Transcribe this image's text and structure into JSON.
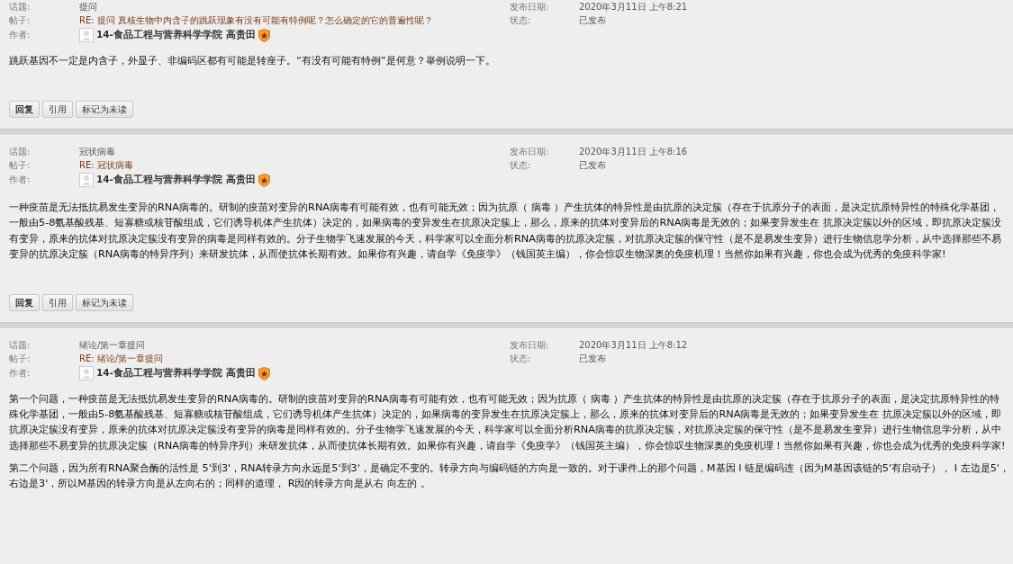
{
  "posts": [
    {
      "labels": {
        "topic": "话题:",
        "post": "帖子:",
        "author": "作者:",
        "date": "发布日期:",
        "status": "状态:"
      },
      "topic": "提问",
      "post": "RE: 提问 真核生物中内含子的跳跃现象有没有可能有特例呢？怎么确定的它的普遍性呢？",
      "author": "14-食品工程与营养科学学院 高贵田",
      "date": "2020年3月11日 上午8:21",
      "status": "已发布",
      "paragraphs": [
        "跳跃基因不一定是内含子，外显子、非编码区都有可能是转座子。“有没有可能有特例”是何意？举例说明一下。"
      ],
      "buttons": [
        "回复",
        "引用",
        "标记为未读"
      ]
    },
    {
      "labels": {
        "topic": "话题:",
        "post": "帖子:",
        "author": "作者:",
        "date": "发布日期:",
        "status": "状态:"
      },
      "topic": "冠状病毒",
      "post": "RE: 冠状病毒",
      "author": "14-食品工程与营养科学学院 高贵田",
      "date": "2020年3月11日 上午8:16",
      "status": "已发布",
      "paragraphs": [
        "一种疫苗是无法抵抗易发生变异的RNA病毒的。研制的疫苗对变异的RNA病毒有可能有效，也有可能无效；因为抗原（ 病毒 ）产生抗体的特异性是由抗原的决定簇（存在于抗原分子的表面，是决定抗原特异性的特殊化学基团，一般由5-8氨基酸残基、短寡糖或核苷酸组成，它们诱导机体产生抗体）决定的，如果病毒的变异发生在抗原决定簇上，那么，原来的抗体对变异后的RNA病毒是无效的；如果变异发生在 抗原决定簇以外的区域，即抗原决定簇没有变异，原来的抗体对抗原决定簇没有变异的病毒是同样有效的。分子生物学飞速发展的今天，科学家可以全面分析RNA病毒的抗原决定簇，对抗原决定簇的保守性（是不是易发生变异）进行生物信息学分析，从中选择那些不易变异的抗原决定簇（RNA病毒的特异序列）来研发抗体，从而使抗体长期有效。如果你有兴趣，请自学《免疫学》（钱国英主编），你会惊叹生物深奥的免疫机理！当然你如果有兴趣，你也会成为优秀的免疫科学家!"
      ],
      "buttons": [
        "回复",
        "引用",
        "标记为未读"
      ]
    },
    {
      "labels": {
        "topic": "话题:",
        "post": "帖子:",
        "author": "作者:",
        "date": "发布日期:",
        "status": "状态:"
      },
      "topic": "绪论/第一章提问",
      "post": "RE: 绪论/第一章提问",
      "author": "14-食品工程与营养科学学院 高贵田",
      "date": "2020年3月11日 上午8:12",
      "status": "已发布",
      "paragraphs": [
        "第一个问题，一种疫苗是无法抵抗易发生变异的RNA病毒的。研制的疫苗对变异的RNA病毒有可能有效，也有可能无效；因为抗原（ 病毒 ）产生抗体的特异性是由抗原的决定簇（存在于抗原分子的表面，是决定抗原特异性的特殊化学基团，一般由5-8氨基酸残基、短寡糖或核苷酸组成，它们诱导机体产生抗体）决定的，如果病毒的变异发生在抗原决定簇上，那么，原来的抗体对变异后的RNA病毒是无效的；如果变异发生在 抗原决定簇以外的区域，即抗原决定簇没有变异，原来的抗体对抗原决定簇没有变异的病毒是同样有效的。分子生物学飞速发展的今天，科学家可以全面分析RNA病毒的抗原决定簇，对抗原决定簇的保守性（是不是易发生变异）进行生物信息学分析，从中选择那些不易变异的抗原决定簇（RNA病毒的特异序列）来研发抗体，从而使抗体长期有效。如果你有兴趣，请自学《免疫学》（钱国英主编），你会惊叹生物深奥的免疫机理！当然你如果有兴趣，你也会成为优秀的免疫科学家!",
        "第二个问题，因为所有RNA聚合酶的活性是 5'到3'，RNA转录方向永远是5'到3'，是确定不变的。转录方向与编码链的方向是一致的。对于课件上的那个问题，M基因 I 链是编码连（因为M基因该链的5'有启动子）， I 左边是5'，右边是3'，所以M基因的转录方向是从左向右的；同样的道理，  R因的转录方向是从右 向左的 。"
      ]
    }
  ]
}
